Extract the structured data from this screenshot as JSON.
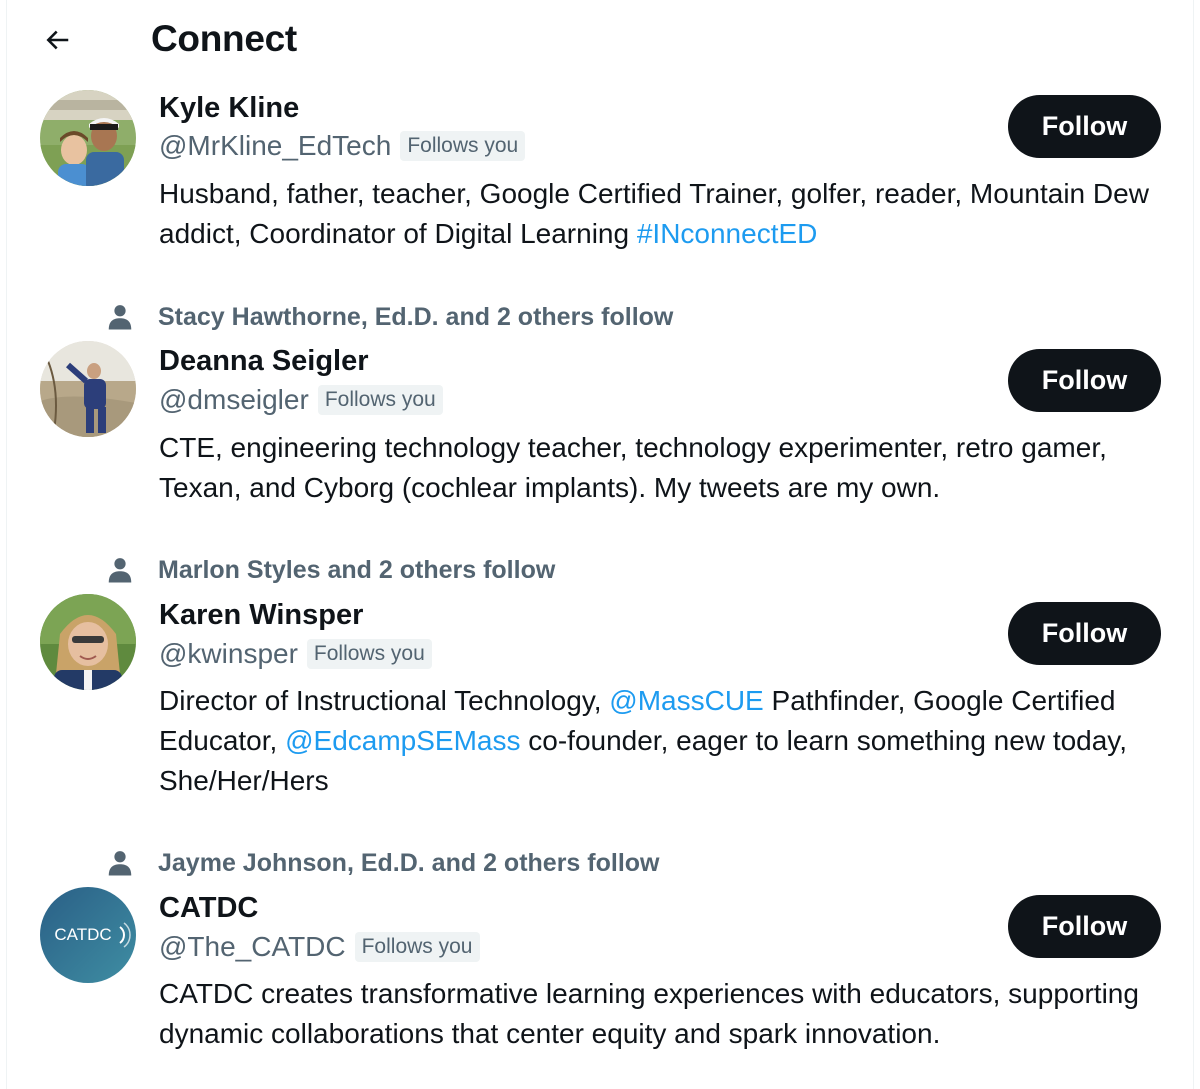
{
  "header": {
    "back_icon": "arrow-left-icon",
    "title": "Connect"
  },
  "colors": {
    "text_primary": "#0f1419",
    "text_secondary": "#536471",
    "link": "#1d9bf0",
    "button_bg": "#0f1419",
    "button_text": "#ffffff",
    "badge_bg": "#eff3f4",
    "catdc_logo_bg": "#2f6d8f"
  },
  "users": [
    {
      "social_context": "",
      "name": "Kyle Kline",
      "handle": "@MrKline_EdTech",
      "follows_you": "Follows you",
      "bio_parts": [
        "Husband, father, teacher, Google Certified Trainer, golfer, reader, Mountain Dew addict, Coordinator of Digital Learning ",
        "#INconnectED",
        ""
      ],
      "follow_label": "Follow",
      "avatar": "photo"
    },
    {
      "social_context": "Stacy Hawthorne, Ed.D. and 2 others follow",
      "name": "Deanna Seigler",
      "handle": "@dmseigler",
      "follows_you": "Follows you",
      "bio": "CTE, engineering technology teacher, technology experimenter, retro gamer, Texan, and Cyborg (cochlear implants). My tweets are my own.",
      "follow_label": "Follow",
      "avatar": "photo"
    },
    {
      "social_context": "Marlon Styles and 2 others follow",
      "name": "Karen Winsper",
      "handle": "@kwinsper",
      "follows_you": "Follows you",
      "bio_parts": [
        "Director of Instructional Technology, ",
        "@MassCUE",
        " Pathfinder, Google Certified Educator, ",
        "@EdcampSEMass",
        " co-founder, eager to learn something new today, She/Her/Hers"
      ],
      "follow_label": "Follow",
      "avatar": "photo"
    },
    {
      "social_context": "Jayme Johnson, Ed.D. and 2 others follow",
      "name": "CATDC",
      "handle": "@The_CATDC",
      "follows_you": "Follows you",
      "bio": "CATDC creates transformative learning experiences with educators, supporting dynamic collaborations that center equity and spark innovation.",
      "follow_label": "Follow",
      "avatar": "logo",
      "logo_text": "CATDC"
    }
  ],
  "icons": {
    "social_context": "person-icon"
  }
}
